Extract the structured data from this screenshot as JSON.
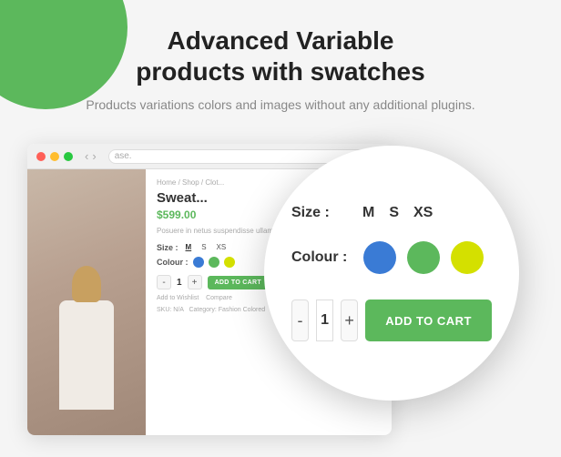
{
  "page": {
    "bg_circle": "decorative",
    "header": {
      "title_line1": "Advanced Variable",
      "title_line2": "products with swatches",
      "subtitle": "Products variations colors and images without any additional plugins."
    },
    "browser": {
      "dots": [
        "red",
        "yellow",
        "green"
      ],
      "nav_back": "‹",
      "nav_forward": "›",
      "address": "ase.",
      "breadcrumb": "Home / Shop / Clot...",
      "product": {
        "title": "Sweat...",
        "price": "$599.00",
        "description": "Posuere in netus suspendisse ullam, consectetur a eros habitasse.",
        "size_label": "Size :",
        "size_options": [
          "M",
          "S",
          "XS"
        ],
        "colour_label": "Colour :",
        "colours": [
          "#3a7bd5",
          "#5cb85c",
          "#d4e000"
        ],
        "quantity": "1",
        "add_to_cart_small": "ADD TO CART",
        "wishlist_text": "Add to Wishlist",
        "compare_text": "Compare",
        "sku_label": "SKU:",
        "sku_value": "N/A",
        "category_label": "Category:",
        "category_value": "Fashion Colored"
      }
    },
    "zoom": {
      "size_label": "Size :",
      "size_options": [
        "M",
        "S",
        "XS"
      ],
      "colour_label": "Colour :",
      "colours": [
        "#3a7bd5",
        "#5cb85c",
        "#d4e000"
      ],
      "qty_minus": "-",
      "qty_value": "1",
      "qty_plus": "+",
      "add_to_cart": "ADD TO CART"
    }
  }
}
